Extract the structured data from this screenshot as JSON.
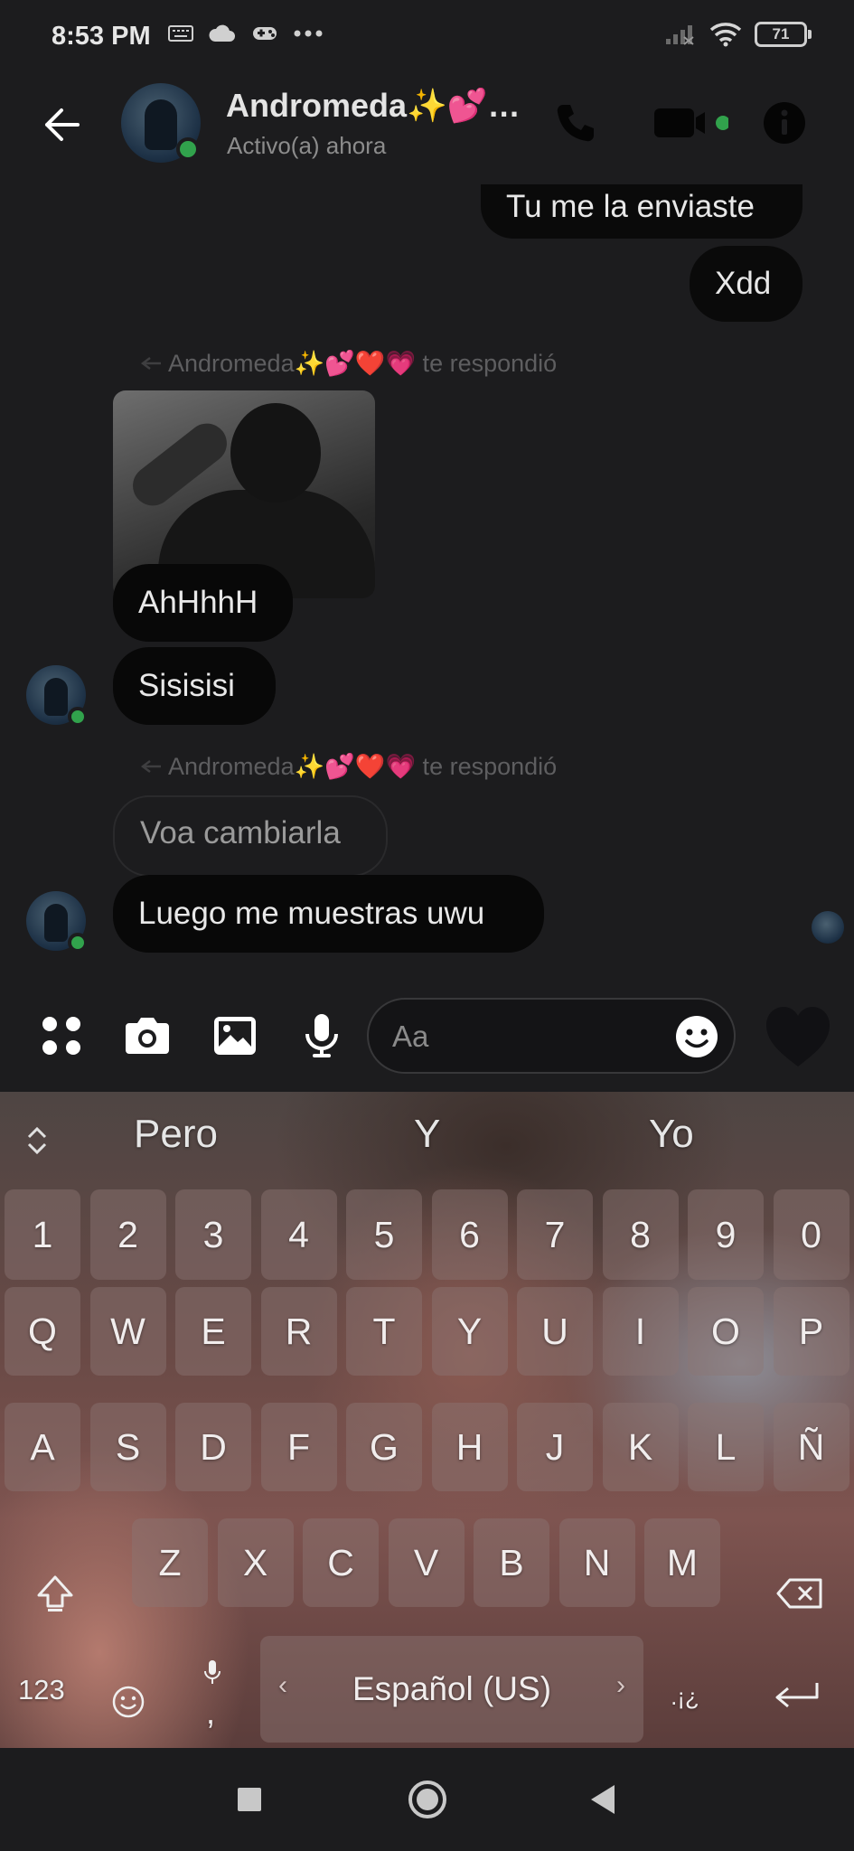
{
  "status_bar": {
    "time": "8:53 PM",
    "battery": "71"
  },
  "header": {
    "contact_name": "Andromeda✨💕…",
    "contact_status": "Activo(a) ahora"
  },
  "chat": {
    "messages_out": [
      {
        "text": "Tu me la enviaste"
      },
      {
        "text": "Xdd"
      }
    ],
    "reply_label_1": "Andromeda✨💕❤️💗 te respondió",
    "messages_in_1": [
      {
        "text": "AhHhhH"
      },
      {
        "text": "Sisisisi"
      }
    ],
    "reply_label_2": "Andromeda✨💕❤️💗 te respondió",
    "quoted_message": "Voa cambiarla",
    "reply_message": "Luego me muestras uwu"
  },
  "composer": {
    "placeholder": "Aa"
  },
  "keyboard": {
    "suggestions": [
      "Pero",
      "Y",
      "Yo"
    ],
    "number_row": [
      "1",
      "2",
      "3",
      "4",
      "5",
      "6",
      "7",
      "8",
      "9",
      "0"
    ],
    "row1": [
      "Q",
      "W",
      "E",
      "R",
      "T",
      "Y",
      "U",
      "I",
      "O",
      "P"
    ],
    "row2": [
      "A",
      "S",
      "D",
      "F",
      "G",
      "H",
      "J",
      "K",
      "L",
      "Ñ"
    ],
    "row3": [
      "Z",
      "X",
      "C",
      "V",
      "B",
      "N",
      "M"
    ],
    "mode_key": "123",
    "space_label": "Español (US)",
    "comma": ",",
    "punct_key": ".¡¿"
  },
  "colors": {
    "background": "#1c1c1e",
    "bubble": "#080808",
    "online": "#31a24c"
  }
}
